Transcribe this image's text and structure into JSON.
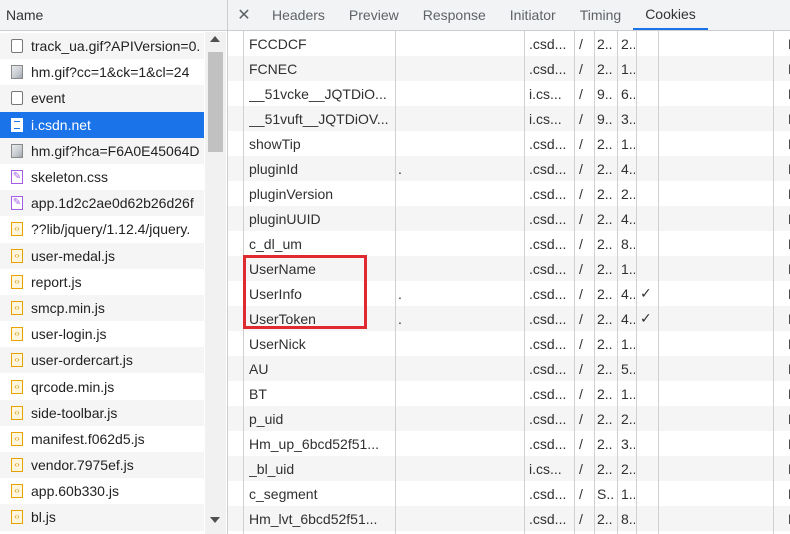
{
  "request_list": {
    "header": "Name",
    "items": [
      {
        "name": "track_ua.gif?APIVersion=0.",
        "type": "doc",
        "icon": "document-icon"
      },
      {
        "name": "hm.gif?cc=1&ck=1&cl=24",
        "type": "img",
        "icon": "image-icon"
      },
      {
        "name": "event",
        "type": "doc",
        "icon": "document-icon"
      },
      {
        "name": "i.csdn.net",
        "type": "dom",
        "icon": "html-document-icon",
        "selected": true
      },
      {
        "name": "hm.gif?hca=F6A0E45064D",
        "type": "img",
        "icon": "image-icon"
      },
      {
        "name": "skeleton.css",
        "type": "css",
        "icon": "stylesheet-icon"
      },
      {
        "name": "app.1d2c2ae0d62b26d26f",
        "type": "css",
        "icon": "stylesheet-icon"
      },
      {
        "name": "??lib/jquery/1.12.4/jquery.",
        "type": "js",
        "icon": "script-icon"
      },
      {
        "name": "user-medal.js",
        "type": "js",
        "icon": "script-icon"
      },
      {
        "name": "report.js",
        "type": "js",
        "icon": "script-icon"
      },
      {
        "name": "smcp.min.js",
        "type": "js",
        "icon": "script-icon"
      },
      {
        "name": "user-login.js",
        "type": "js",
        "icon": "script-icon"
      },
      {
        "name": "user-ordercart.js",
        "type": "js",
        "icon": "script-icon"
      },
      {
        "name": "qrcode.min.js",
        "type": "js",
        "icon": "script-icon"
      },
      {
        "name": "side-toolbar.js",
        "type": "js",
        "icon": "script-icon"
      },
      {
        "name": "manifest.f062d5.js",
        "type": "js",
        "icon": "script-icon"
      },
      {
        "name": "vendor.7975ef.js",
        "type": "js",
        "icon": "script-icon"
      },
      {
        "name": "app.60b330.js",
        "type": "js",
        "icon": "script-icon"
      },
      {
        "name": "bl.js",
        "type": "js",
        "icon": "script-icon"
      }
    ]
  },
  "tabs": {
    "close_icon": "close-icon",
    "items": [
      "Headers",
      "Preview",
      "Response",
      "Initiator",
      "Timing",
      "Cookies"
    ],
    "active": "Cookies"
  },
  "cookies": {
    "rows": [
      {
        "name": "FCCDCF",
        "value": "",
        "domain": ".csd...",
        "path": "/",
        "expires": "2...",
        "size": "2...",
        "http": "",
        "secure": "",
        "samesite": "",
        "priority": "M"
      },
      {
        "name": "FCNEC",
        "value": "",
        "domain": ".csd...",
        "path": "/",
        "expires": "2...",
        "size": "1...",
        "http": "",
        "secure": "",
        "samesite": "",
        "priority": "M"
      },
      {
        "name": "__51vcke__JQTDiO...",
        "value": "",
        "domain": "i.cs...",
        "path": "/",
        "expires": "9...",
        "size": "6...",
        "http": "",
        "secure": "",
        "samesite": "",
        "priority": "M"
      },
      {
        "name": "__51vuft__JQTDiOV...",
        "value": "",
        "domain": "i.cs...",
        "path": "/",
        "expires": "9...",
        "size": "3...",
        "http": "",
        "secure": "",
        "samesite": "",
        "priority": "M"
      },
      {
        "name": "showTip",
        "value": "",
        "domain": ".csd...",
        "path": "/",
        "expires": "2...",
        "size": "1...",
        "http": "",
        "secure": "",
        "samesite": "",
        "priority": "M"
      },
      {
        "name": "pluginId",
        "value": ".",
        "domain": ".csd...",
        "path": "/",
        "expires": "2...",
        "size": "4...",
        "http": "",
        "secure": "",
        "samesite": "",
        "priority": "M"
      },
      {
        "name": "pluginVersion",
        "value": "",
        "domain": ".csd...",
        "path": "/",
        "expires": "2...",
        "size": "2...",
        "http": "",
        "secure": "",
        "samesite": "",
        "priority": "M"
      },
      {
        "name": "pluginUUID",
        "value": "",
        "domain": ".csd...",
        "path": "/",
        "expires": "2...",
        "size": "4...",
        "http": "",
        "secure": "",
        "samesite": "",
        "priority": "M"
      },
      {
        "name": "c_dl_um",
        "value": "",
        "domain": ".csd...",
        "path": "/",
        "expires": "2...",
        "size": "8...",
        "http": "",
        "secure": "",
        "samesite": "",
        "priority": "M"
      },
      {
        "name": "UserName",
        "value": "",
        "domain": ".csd...",
        "path": "/",
        "expires": "2...",
        "size": "1...",
        "http": "",
        "secure": "",
        "samesite": "",
        "priority": "M"
      },
      {
        "name": "UserInfo",
        "value": ".",
        "domain": ".csd...",
        "path": "/",
        "expires": "2...",
        "size": "4...",
        "http": "✓",
        "secure": "",
        "samesite": "",
        "priority": "M"
      },
      {
        "name": "UserToken",
        "value": ".",
        "domain": ".csd...",
        "path": "/",
        "expires": "2...",
        "size": "4...",
        "http": "✓",
        "secure": "",
        "samesite": "",
        "priority": "M"
      },
      {
        "name": "UserNick",
        "value": "",
        "domain": ".csd...",
        "path": "/",
        "expires": "2...",
        "size": "1...",
        "http": "",
        "secure": "",
        "samesite": "",
        "priority": "M"
      },
      {
        "name": "AU",
        "value": "",
        "domain": ".csd...",
        "path": "/",
        "expires": "2...",
        "size": "5...",
        "http": "",
        "secure": "",
        "samesite": "",
        "priority": "M"
      },
      {
        "name": "BT",
        "value": "",
        "domain": ".csd...",
        "path": "/",
        "expires": "2...",
        "size": "1...",
        "http": "",
        "secure": "",
        "samesite": "",
        "priority": "M"
      },
      {
        "name": "p_uid",
        "value": "",
        "domain": ".csd...",
        "path": "/",
        "expires": "2...",
        "size": "2...",
        "http": "",
        "secure": "",
        "samesite": "",
        "priority": "M"
      },
      {
        "name": "Hm_up_6bcd52f51...",
        "value": "",
        "domain": ".csd...",
        "path": "/",
        "expires": "2...",
        "size": "3...",
        "http": "",
        "secure": "",
        "samesite": "",
        "priority": "M"
      },
      {
        "name": "_bl_uid",
        "value": "",
        "domain": "i.cs...",
        "path": "/",
        "expires": "2...",
        "size": "2...",
        "http": "",
        "secure": "",
        "samesite": "",
        "priority": "M"
      },
      {
        "name": "c_segment",
        "value": "",
        "domain": ".csd...",
        "path": "/",
        "expires": "S...",
        "size": "1...",
        "http": "",
        "secure": "",
        "samesite": "",
        "priority": "M"
      },
      {
        "name": "Hm_lvt_6bcd52f51...",
        "value": "",
        "domain": ".csd...",
        "path": "/",
        "expires": "2...",
        "size": "8...",
        "http": "",
        "secure": "",
        "samesite": "",
        "priority": "M"
      }
    ],
    "highlight_color": "#e02a32"
  },
  "colors": {
    "accent": "#1a73e8",
    "highlight": "#e02a32"
  }
}
